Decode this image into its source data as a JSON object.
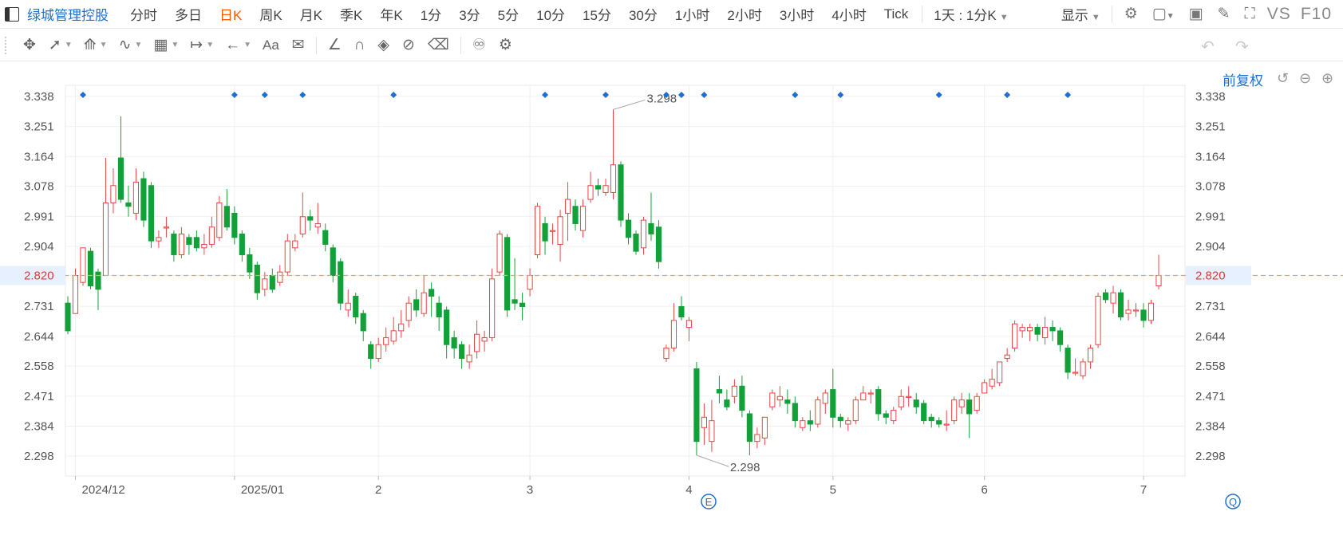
{
  "toolbar": {
    "stock_name": "绿城管理控股",
    "periods": [
      "分时",
      "多日",
      "日K",
      "周K",
      "月K",
      "季K",
      "年K",
      "1分",
      "3分",
      "5分",
      "10分",
      "15分",
      "30分",
      "1小时",
      "2小时",
      "3小时",
      "4小时",
      "Tick"
    ],
    "active_period": "日K",
    "range_combo": "1天 : 1分K",
    "display_label": "显示",
    "vs_label": "VS",
    "f10_label": "F10"
  },
  "chart_header": {
    "adjust_label": "前复权"
  },
  "colors": {
    "up": "#e84646",
    "down": "#12a139",
    "accent": "#1f6fd1",
    "active_period": "#ff5a00",
    "last_price_line": "#f0a05a"
  },
  "chart_data": {
    "type": "candlestick",
    "ylim": [
      2.24,
      3.37
    ],
    "y_ticks": [
      "3.338",
      "3.251",
      "3.164",
      "3.078",
      "2.991",
      "2.904",
      "2.820",
      "2.731",
      "2.644",
      "2.558",
      "2.471",
      "2.384",
      "2.298"
    ],
    "x_tick_labels": [
      "2024/12",
      "2025/01",
      "2",
      "3",
      "4",
      "5",
      "6",
      "7"
    ],
    "last_price": "2.820",
    "high_label": "3.298",
    "low_label": "2.298",
    "event_markers": [
      "E",
      "Q"
    ],
    "candles": [
      [
        2.74,
        2.66,
        2.76,
        2.65
      ],
      [
        2.71,
        2.82,
        2.84,
        2.71
      ],
      [
        2.8,
        2.9,
        2.9,
        2.79
      ],
      [
        2.89,
        2.79,
        2.9,
        2.78
      ],
      [
        2.83,
        2.78,
        2.84,
        2.72
      ],
      [
        2.82,
        3.03,
        3.16,
        2.82
      ],
      [
        3.03,
        3.08,
        3.13,
        3.0
      ],
      [
        3.16,
        3.04,
        3.28,
        3.03
      ],
      [
        3.03,
        3.02,
        3.08,
        2.99
      ],
      [
        3.0,
        3.09,
        3.13,
        2.98
      ],
      [
        3.1,
        2.98,
        3.12,
        2.96
      ],
      [
        3.08,
        2.92,
        3.09,
        2.9
      ],
      [
        2.92,
        2.93,
        2.95,
        2.9
      ],
      [
        2.96,
        2.96,
        2.99,
        2.93
      ],
      [
        2.94,
        2.88,
        2.95,
        2.86
      ],
      [
        2.88,
        2.94,
        2.96,
        2.87
      ],
      [
        2.93,
        2.91,
        2.94,
        2.88
      ],
      [
        2.93,
        2.9,
        2.95,
        2.89
      ],
      [
        2.9,
        2.91,
        2.94,
        2.88
      ],
      [
        2.91,
        2.96,
        2.99,
        2.9
      ],
      [
        2.93,
        3.03,
        3.05,
        2.92
      ],
      [
        3.02,
        2.96,
        3.07,
        2.95
      ],
      [
        3.0,
        2.93,
        3.02,
        2.91
      ],
      [
        2.94,
        2.88,
        2.95,
        2.86
      ],
      [
        2.88,
        2.83,
        2.9,
        2.81
      ],
      [
        2.85,
        2.77,
        2.86,
        2.75
      ],
      [
        2.78,
        2.81,
        2.83,
        2.76
      ],
      [
        2.82,
        2.78,
        2.84,
        2.77
      ],
      [
        2.8,
        2.83,
        2.85,
        2.79
      ],
      [
        2.83,
        2.92,
        2.94,
        2.82
      ],
      [
        2.9,
        2.92,
        2.94,
        2.89
      ],
      [
        2.94,
        2.99,
        3.06,
        2.93
      ],
      [
        2.99,
        2.98,
        3.01,
        2.95
      ],
      [
        2.96,
        2.97,
        3.03,
        2.94
      ],
      [
        2.95,
        2.91,
        2.97,
        2.89
      ],
      [
        2.9,
        2.82,
        2.91,
        2.8
      ],
      [
        2.86,
        2.74,
        2.87,
        2.72
      ],
      [
        2.72,
        2.74,
        2.78,
        2.7
      ],
      [
        2.76,
        2.7,
        2.77,
        2.68
      ],
      [
        2.71,
        2.66,
        2.72,
        2.63
      ],
      [
        2.62,
        2.58,
        2.63,
        2.55
      ],
      [
        2.58,
        2.62,
        2.64,
        2.57
      ],
      [
        2.62,
        2.64,
        2.67,
        2.6
      ],
      [
        2.63,
        2.66,
        2.7,
        2.62
      ],
      [
        2.66,
        2.68,
        2.72,
        2.64
      ],
      [
        2.69,
        2.74,
        2.76,
        2.67
      ],
      [
        2.75,
        2.72,
        2.78,
        2.7
      ],
      [
        2.71,
        2.77,
        2.82,
        2.7
      ],
      [
        2.78,
        2.76,
        2.8,
        2.7
      ],
      [
        2.74,
        2.7,
        2.76,
        2.66
      ],
      [
        2.72,
        2.62,
        2.73,
        2.58
      ],
      [
        2.64,
        2.61,
        2.66,
        2.58
      ],
      [
        2.62,
        2.58,
        2.63,
        2.55
      ],
      [
        2.57,
        2.59,
        2.62,
        2.55
      ],
      [
        2.6,
        2.65,
        2.69,
        2.58
      ],
      [
        2.63,
        2.64,
        2.66,
        2.6
      ],
      [
        2.64,
        2.81,
        2.84,
        2.63
      ],
      [
        2.83,
        2.94,
        2.95,
        2.82
      ],
      [
        2.93,
        2.72,
        2.94,
        2.7
      ],
      [
        2.75,
        2.74,
        2.87,
        2.72
      ],
      [
        2.74,
        2.73,
        2.77,
        2.69
      ],
      [
        2.78,
        2.82,
        2.84,
        2.76
      ],
      [
        2.88,
        3.02,
        3.03,
        2.87
      ],
      [
        2.97,
        2.92,
        2.99,
        2.88
      ],
      [
        2.95,
        2.95,
        2.97,
        2.91
      ],
      [
        2.91,
        2.99,
        3.01,
        2.86
      ],
      [
        3.0,
        3.04,
        3.09,
        2.92
      ],
      [
        3.02,
        2.97,
        3.04,
        2.95
      ],
      [
        2.95,
        3.02,
        3.04,
        2.93
      ],
      [
        3.04,
        3.08,
        3.12,
        3.03
      ],
      [
        3.08,
        3.07,
        3.1,
        3.05
      ],
      [
        3.06,
        3.08,
        3.1,
        3.05
      ],
      [
        3.06,
        3.14,
        3.3,
        3.04
      ],
      [
        3.14,
        2.98,
        3.15,
        2.96
      ],
      [
        2.98,
        2.93,
        3.0,
        2.91
      ],
      [
        2.94,
        2.89,
        2.95,
        2.88
      ],
      [
        2.9,
        2.98,
        2.99,
        2.88
      ],
      [
        2.97,
        2.94,
        3.06,
        2.92
      ],
      [
        2.96,
        2.86,
        2.98,
        2.84
      ],
      [
        2.58,
        2.61,
        2.62,
        2.57
      ],
      [
        2.61,
        2.69,
        2.74,
        2.6
      ],
      [
        2.73,
        2.7,
        2.76,
        2.69
      ],
      [
        2.67,
        2.69,
        2.7,
        2.63
      ],
      [
        2.55,
        2.34,
        2.57,
        2.3
      ],
      [
        2.38,
        2.41,
        2.45,
        2.33
      ],
      [
        2.34,
        2.4,
        2.46,
        2.31
      ],
      [
        2.49,
        2.48,
        2.53,
        2.45
      ],
      [
        2.46,
        2.44,
        2.49,
        2.43
      ],
      [
        2.47,
        2.5,
        2.52,
        2.45
      ],
      [
        2.5,
        2.43,
        2.53,
        2.41
      ],
      [
        2.42,
        2.34,
        2.43,
        2.3
      ],
      [
        2.34,
        2.36,
        2.38,
        2.32
      ],
      [
        2.35,
        2.41,
        2.41,
        2.33
      ],
      [
        2.44,
        2.48,
        2.49,
        2.43
      ],
      [
        2.46,
        2.47,
        2.5,
        2.44
      ],
      [
        2.46,
        2.45,
        2.49,
        2.42
      ],
      [
        2.45,
        2.4,
        2.47,
        2.38
      ],
      [
        2.38,
        2.4,
        2.41,
        2.37
      ],
      [
        2.4,
        2.39,
        2.43,
        2.37
      ],
      [
        2.39,
        2.46,
        2.47,
        2.38
      ],
      [
        2.45,
        2.48,
        2.49,
        2.42
      ],
      [
        2.49,
        2.41,
        2.55,
        2.38
      ],
      [
        2.41,
        2.4,
        2.42,
        2.38
      ],
      [
        2.39,
        2.4,
        2.41,
        2.37
      ],
      [
        2.4,
        2.46,
        2.47,
        2.39
      ],
      [
        2.46,
        2.48,
        2.5,
        2.46
      ],
      [
        2.48,
        2.48,
        2.49,
        2.45
      ],
      [
        2.49,
        2.42,
        2.5,
        2.4
      ],
      [
        2.42,
        2.41,
        2.43,
        2.39
      ],
      [
        2.4,
        2.43,
        2.44,
        2.39
      ],
      [
        2.44,
        2.47,
        2.49,
        2.43
      ],
      [
        2.47,
        2.47,
        2.5,
        2.44
      ],
      [
        2.46,
        2.44,
        2.48,
        2.42
      ],
      [
        2.45,
        2.4,
        2.46,
        2.39
      ],
      [
        2.41,
        2.4,
        2.42,
        2.38
      ],
      [
        2.4,
        2.39,
        2.41,
        2.38
      ],
      [
        2.39,
        2.39,
        2.43,
        2.37
      ],
      [
        2.4,
        2.46,
        2.47,
        2.39
      ],
      [
        2.44,
        2.46,
        2.48,
        2.42
      ],
      [
        2.46,
        2.42,
        2.48,
        2.35
      ],
      [
        2.43,
        2.47,
        2.48,
        2.42
      ],
      [
        2.48,
        2.51,
        2.52,
        2.48
      ],
      [
        2.5,
        2.52,
        2.55,
        2.49
      ],
      [
        2.51,
        2.57,
        2.57,
        2.5
      ],
      [
        2.58,
        2.59,
        2.61,
        2.57
      ],
      [
        2.61,
        2.68,
        2.69,
        2.6
      ],
      [
        2.66,
        2.67,
        2.68,
        2.64
      ],
      [
        2.66,
        2.67,
        2.68,
        2.63
      ],
      [
        2.67,
        2.65,
        2.68,
        2.63
      ],
      [
        2.64,
        2.67,
        2.7,
        2.62
      ],
      [
        2.67,
        2.66,
        2.69,
        2.63
      ],
      [
        2.66,
        2.62,
        2.67,
        2.6
      ],
      [
        2.61,
        2.54,
        2.62,
        2.52
      ],
      [
        2.54,
        2.54,
        2.58,
        2.53
      ],
      [
        2.53,
        2.57,
        2.58,
        2.52
      ],
      [
        2.57,
        2.61,
        2.62,
        2.55
      ],
      [
        2.62,
        2.76,
        2.77,
        2.61
      ],
      [
        2.77,
        2.75,
        2.78,
        2.74
      ],
      [
        2.74,
        2.77,
        2.79,
        2.71
      ],
      [
        2.77,
        2.7,
        2.78,
        2.69
      ],
      [
        2.71,
        2.72,
        2.75,
        2.69
      ],
      [
        2.72,
        2.72,
        2.74,
        2.7
      ],
      [
        2.72,
        2.69,
        2.74,
        2.67
      ],
      [
        2.69,
        2.74,
        2.75,
        2.68
      ],
      [
        2.79,
        2.82,
        2.88,
        2.78
      ]
    ]
  }
}
